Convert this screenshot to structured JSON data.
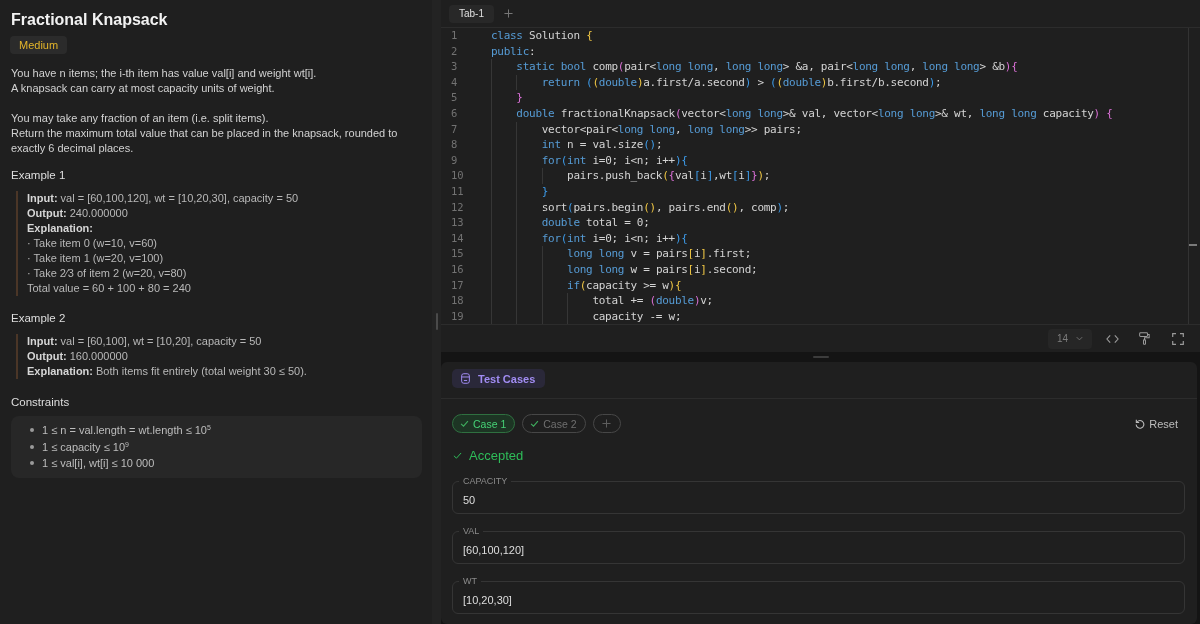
{
  "problem": {
    "title": "Fractional Knapsack",
    "difficulty": {
      "label": "Medium",
      "kind": "medium"
    },
    "description": [
      [
        "You have n items; the i-th item has value val[i] and weight wt[i].",
        "A knapsack can carry at most capacity units of weight."
      ],
      [
        "You may take any fraction of an item (i.e. split items).",
        "Return the maximum total value that can be placed in the knapsack, rounded to exactly 6 decimal places."
      ]
    ],
    "examples": [
      {
        "heading": "Example 1",
        "lines": [
          {
            "label": "Input:",
            "text": "val = [60,100,120], wt = [10,20,30], capacity = 50"
          },
          {
            "label": "Output:",
            "text": "240.000000"
          },
          {
            "label": "Explanation:"
          },
          {
            "text": "· Take item 0 (w=10, v=60)"
          },
          {
            "text": "· Take item 1 (w=20, v=100)"
          },
          {
            "text": "· Take 2⁄3 of item 2 (w=20, v=80)"
          },
          {
            "text": "Total value = 60 + 100 + 80 = 240"
          }
        ]
      },
      {
        "heading": "Example 2",
        "lines": [
          {
            "label": "Input:",
            "text": "val = [60,100], wt = [10,20], capacity = 50"
          },
          {
            "label": "Output:",
            "text": "160.000000"
          },
          {
            "label": "Explanation:",
            "text": "Both items fit entirely (total weight 30 ≤ 50)."
          }
        ]
      }
    ],
    "constraints_heading": "Constraints",
    "constraints": [
      "1 ≤ n = val.length = wt.length ≤ 10$^{5}$",
      "1 ≤ capacity ≤ 10$^{9}$",
      "1 ≤ val[i], wt[i] ≤ 10 000"
    ]
  },
  "editor": {
    "tabs": [
      {
        "label": "Tab-1",
        "selected": true
      }
    ],
    "lines": [
      {
        "number": "1",
        "tokens": [
          {
            "kind": "keyword",
            "text": "class"
          },
          {
            "kind": "plain",
            "text": " Solution "
          },
          {
            "kind": "brace1",
            "text": "{"
          }
        ]
      },
      {
        "number": "2",
        "tokens": [
          {
            "kind": "keyword",
            "text": "public"
          },
          {
            "kind": "plain",
            "text": ":"
          }
        ],
        "children": [
          {
            "number": "3",
            "tokens": [
              {
                "kind": "keyword",
                "text": "static bool"
              },
              {
                "kind": "plain",
                "text": " comp"
              },
              {
                "kind": "brace2",
                "text": "("
              },
              {
                "kind": "plain",
                "text": "pair<"
              },
              {
                "kind": "keyword",
                "text": "long long"
              },
              {
                "kind": "plain",
                "text": ", "
              },
              {
                "kind": "keyword",
                "text": "long long"
              },
              {
                "kind": "plain",
                "text": "> &a, pair<"
              },
              {
                "kind": "keyword",
                "text": "long long"
              },
              {
                "kind": "plain",
                "text": ", "
              },
              {
                "kind": "keyword",
                "text": "long long"
              },
              {
                "kind": "plain",
                "text": "> &b"
              },
              {
                "kind": "brace2",
                "text": "){"
              }
            ],
            "children": [
              {
                "number": "4",
                "tokens": [
                  {
                    "kind": "keyword",
                    "text": "return"
                  },
                  {
                    "kind": "brace3",
                    "text": " ("
                  },
                  {
                    "kind": "brace1",
                    "text": "("
                  },
                  {
                    "kind": "keyword",
                    "text": "double"
                  },
                  {
                    "kind": "brace1",
                    "text": ")"
                  },
                  {
                    "kind": "plain",
                    "text": "a.first/a.second"
                  },
                  {
                    "kind": "brace3",
                    "text": ")"
                  },
                  {
                    "kind": "plain",
                    "text": " > "
                  },
                  {
                    "kind": "brace3",
                    "text": "("
                  },
                  {
                    "kind": "brace1",
                    "text": "("
                  },
                  {
                    "kind": "keyword",
                    "text": "double"
                  },
                  {
                    "kind": "brace1",
                    "text": ")"
                  },
                  {
                    "kind": "plain",
                    "text": "b.first/b.second"
                  },
                  {
                    "kind": "brace3",
                    "text": ")"
                  },
                  {
                    "kind": "plain",
                    "text": ";"
                  }
                ]
              }
            ]
          },
          {
            "number": "5",
            "tokens": [
              {
                "kind": "brace2",
                "text": "}"
              }
            ]
          },
          {
            "number": "6",
            "tokens": [
              {
                "kind": "keyword",
                "text": "double"
              },
              {
                "kind": "plain",
                "text": " fractionalKnapsack"
              },
              {
                "kind": "brace2",
                "text": "("
              },
              {
                "kind": "plain",
                "text": "vector<"
              },
              {
                "kind": "keyword",
                "text": "long long"
              },
              {
                "kind": "plain",
                "text": ">& val, vector<"
              },
              {
                "kind": "keyword",
                "text": "long long"
              },
              {
                "kind": "plain",
                "text": ">& wt, "
              },
              {
                "kind": "keyword",
                "text": "long long"
              },
              {
                "kind": "plain",
                "text": " capacity"
              },
              {
                "kind": "brace2",
                "text": ") {"
              }
            ],
            "children": [
              {
                "number": "7",
                "tokens": [
                  {
                    "kind": "plain",
                    "text": "vector<pair<"
                  },
                  {
                    "kind": "keyword",
                    "text": "long long"
                  },
                  {
                    "kind": "plain",
                    "text": ", "
                  },
                  {
                    "kind": "keyword",
                    "text": "long long"
                  },
                  {
                    "kind": "plain",
                    "text": ">> pairs;"
                  }
                ]
              },
              {
                "number": "8",
                "tokens": [
                  {
                    "kind": "keyword",
                    "text": "int"
                  },
                  {
                    "kind": "plain",
                    "text": " n = val.size"
                  },
                  {
                    "kind": "brace3",
                    "text": "()"
                  },
                  {
                    "kind": "plain",
                    "text": ";"
                  }
                ]
              },
              {
                "number": "9",
                "tokens": [
                  {
                    "kind": "keyword",
                    "text": "for"
                  },
                  {
                    "kind": "brace3",
                    "text": "("
                  },
                  {
                    "kind": "keyword",
                    "text": "int"
                  },
                  {
                    "kind": "plain",
                    "text": " i=0; i<n; i++"
                  },
                  {
                    "kind": "brace3",
                    "text": "){"
                  }
                ],
                "children": [
                  {
                    "number": "10",
                    "tokens": [
                      {
                        "kind": "plain",
                        "text": "pairs.push_back"
                      },
                      {
                        "kind": "brace1",
                        "text": "("
                      },
                      {
                        "kind": "brace2",
                        "text": "{"
                      },
                      {
                        "kind": "plain",
                        "text": "val"
                      },
                      {
                        "kind": "brace3",
                        "text": "["
                      },
                      {
                        "kind": "plain",
                        "text": "i"
                      },
                      {
                        "kind": "brace3",
                        "text": "]"
                      },
                      {
                        "kind": "plain",
                        "text": ",wt"
                      },
                      {
                        "kind": "brace3",
                        "text": "["
                      },
                      {
                        "kind": "plain",
                        "text": "i"
                      },
                      {
                        "kind": "brace3",
                        "text": "]"
                      },
                      {
                        "kind": "brace2",
                        "text": "}"
                      },
                      {
                        "kind": "brace1",
                        "text": ")"
                      },
                      {
                        "kind": "plain",
                        "text": ";"
                      }
                    ]
                  }
                ]
              },
              {
                "number": "11",
                "tokens": [
                  {
                    "kind": "brace3",
                    "text": "}"
                  }
                ]
              },
              {
                "number": "12",
                "tokens": [
                  {
                    "kind": "plain",
                    "text": "sort"
                  },
                  {
                    "kind": "brace3",
                    "text": "("
                  },
                  {
                    "kind": "plain",
                    "text": "pairs.begin"
                  },
                  {
                    "kind": "brace1",
                    "text": "()"
                  },
                  {
                    "kind": "plain",
                    "text": ", pairs.end"
                  },
                  {
                    "kind": "brace1",
                    "text": "()"
                  },
                  {
                    "kind": "plain",
                    "text": ", comp"
                  },
                  {
                    "kind": "brace3",
                    "text": ")"
                  },
                  {
                    "kind": "plain",
                    "text": ";"
                  }
                ]
              },
              {
                "number": "13",
                "tokens": [
                  {
                    "kind": "keyword",
                    "text": "double"
                  },
                  {
                    "kind": "plain",
                    "text": " total = 0;"
                  }
                ]
              },
              {
                "number": "14",
                "tokens": [
                  {
                    "kind": "keyword",
                    "text": "for"
                  },
                  {
                    "kind": "brace3",
                    "text": "("
                  },
                  {
                    "kind": "keyword",
                    "text": "int"
                  },
                  {
                    "kind": "plain",
                    "text": " i=0; i<n; i++"
                  },
                  {
                    "kind": "brace3",
                    "text": "){"
                  }
                ],
                "children": [
                  {
                    "number": "15",
                    "tokens": [
                      {
                        "kind": "keyword",
                        "text": "long long"
                      },
                      {
                        "kind": "plain",
                        "text": " v = pairs"
                      },
                      {
                        "kind": "brace1",
                        "text": "["
                      },
                      {
                        "kind": "plain",
                        "text": "i"
                      },
                      {
                        "kind": "brace1",
                        "text": "]"
                      },
                      {
                        "kind": "plain",
                        "text": ".first;"
                      }
                    ]
                  },
                  {
                    "number": "16",
                    "tokens": [
                      {
                        "kind": "keyword",
                        "text": "long long"
                      },
                      {
                        "kind": "plain",
                        "text": " w = pairs"
                      },
                      {
                        "kind": "brace1",
                        "text": "["
                      },
                      {
                        "kind": "plain",
                        "text": "i"
                      },
                      {
                        "kind": "brace1",
                        "text": "]"
                      },
                      {
                        "kind": "plain",
                        "text": ".second;"
                      }
                    ]
                  },
                  {
                    "number": "17",
                    "tokens": [
                      {
                        "kind": "keyword",
                        "text": "if"
                      },
                      {
                        "kind": "brace1",
                        "text": "("
                      },
                      {
                        "kind": "plain",
                        "text": "capacity >= w"
                      },
                      {
                        "kind": "brace1",
                        "text": "){"
                      }
                    ],
                    "children": [
                      {
                        "number": "18",
                        "tokens": [
                          {
                            "kind": "plain",
                            "text": "total += "
                          },
                          {
                            "kind": "brace2",
                            "text": "("
                          },
                          {
                            "kind": "keyword",
                            "text": "double"
                          },
                          {
                            "kind": "brace2",
                            "text": ")"
                          },
                          {
                            "kind": "plain",
                            "text": "v;"
                          }
                        ]
                      },
                      {
                        "number": "19",
                        "tokens": [
                          {
                            "kind": "plain",
                            "text": "capacity -= w;"
                          }
                        ]
                      }
                    ]
                  }
                ]
              }
            ]
          }
        ]
      }
    ],
    "font_size": "14"
  },
  "test_panel": {
    "title": "Test Cases",
    "cases": [
      {
        "label": "Case 1",
        "selected": true,
        "passed": true
      },
      {
        "label": "Case 2",
        "selected": false,
        "passed": true
      }
    ],
    "reset_label": "Reset",
    "result": {
      "label": "Accepted",
      "kind": "accepted"
    },
    "inputs": [
      {
        "label": "CAPACITY",
        "value": "50"
      },
      {
        "label": "VAL",
        "value": "[60,100,120]"
      },
      {
        "label": "WT",
        "value": "[10,20,30]"
      }
    ]
  }
}
